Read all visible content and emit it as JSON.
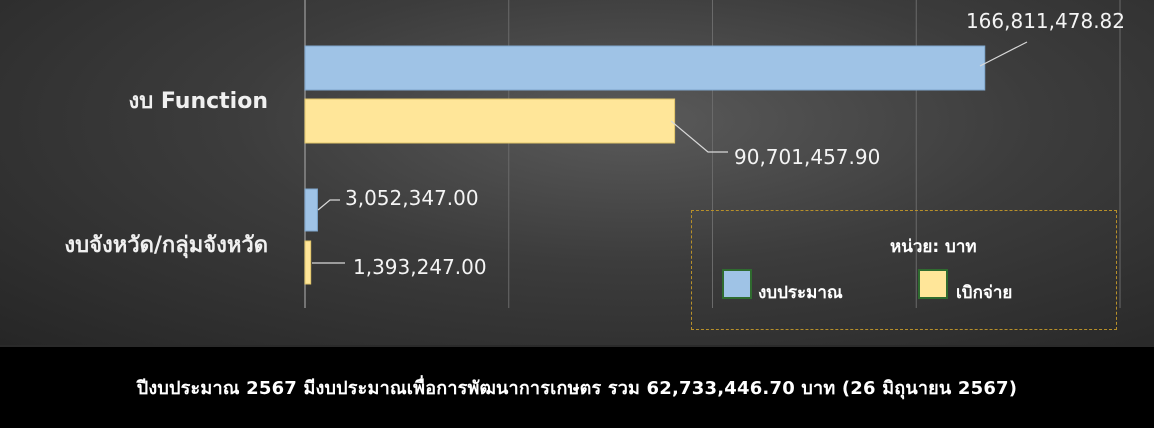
{
  "chart_data": {
    "type": "bar",
    "orientation": "horizontal",
    "categories": [
      "งบ Function",
      "งบจังหวัด/กลุ่มจังหวัด"
    ],
    "series": [
      {
        "name": "งบประมาณ",
        "color": "#9fc3e6",
        "values": [
          166811478.82,
          3052347.0
        ],
        "labels": [
          "166,811,478.82",
          "3,052,347.00"
        ]
      },
      {
        "name": "เบิกจ่าย",
        "color": "#ffe699",
        "values": [
          90701457.9,
          1393247.0
        ],
        "labels": [
          "90,701,457.90",
          "1,393,247.00"
        ]
      }
    ],
    "xlim": [
      0,
      200000000
    ],
    "grid": true,
    "legend_position": "bottom-right",
    "unit_label": "หน่วย: บาท"
  },
  "footer": {
    "text": "ปีงบประมาณ 2567 มีงบประมาณเพื่อการพัฒนาการเกษตร รวม 62,733,446.70 บาท (26 มิถุนายน 2567)"
  },
  "colors": {
    "budget": "#9fc3e6",
    "disbursed": "#ffe699",
    "legend_border": "#b8902a"
  }
}
